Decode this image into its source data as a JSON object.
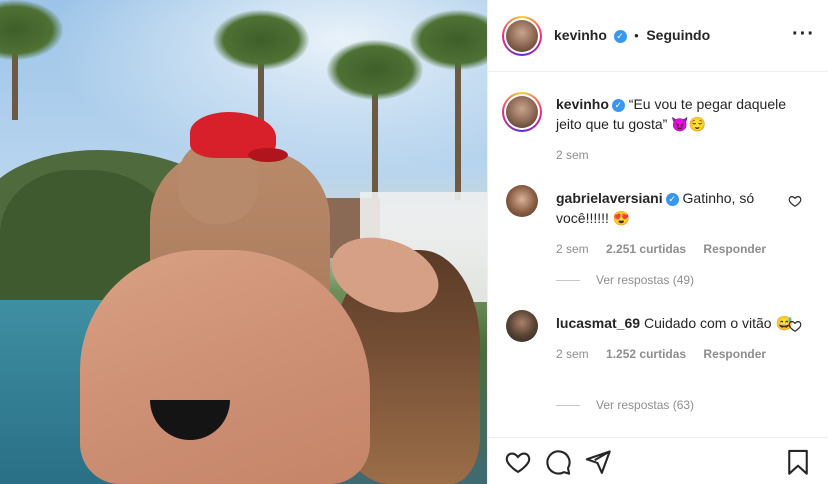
{
  "header": {
    "username": "kevinho",
    "separator": "•",
    "follow_status": "Seguindo",
    "more_icon": "more-horizontal-icon"
  },
  "caption": {
    "username": "kevinho",
    "text": "“Eu vou te pegar daquele jeito que tu gosta”",
    "emoji": "😈😌",
    "time": "2 sem"
  },
  "comments": [
    {
      "username": "gabrielaversiani",
      "text": "Gatinho, só você!!!!!!",
      "emoji": "😍",
      "time": "2 sem",
      "likes": "2.251 curtidas",
      "reply": "Responder",
      "view_replies": "Ver respostas (49)"
    },
    {
      "username": "lucasmat_69",
      "text": "Cuidado com o vitão",
      "emoji": "😅",
      "time": "2 sem",
      "likes": "1.252 curtidas",
      "reply": "Responder",
      "view_replies": "Ver respostas (63)"
    }
  ],
  "actions": {
    "like_icon": "heart-icon",
    "comment_icon": "comment-icon",
    "share_icon": "paper-plane-icon",
    "save_icon": "bookmark-icon"
  },
  "colors": {
    "verified": "#3897f0",
    "text": "#262626",
    "muted": "#8e8e8e",
    "border": "#efefef"
  }
}
